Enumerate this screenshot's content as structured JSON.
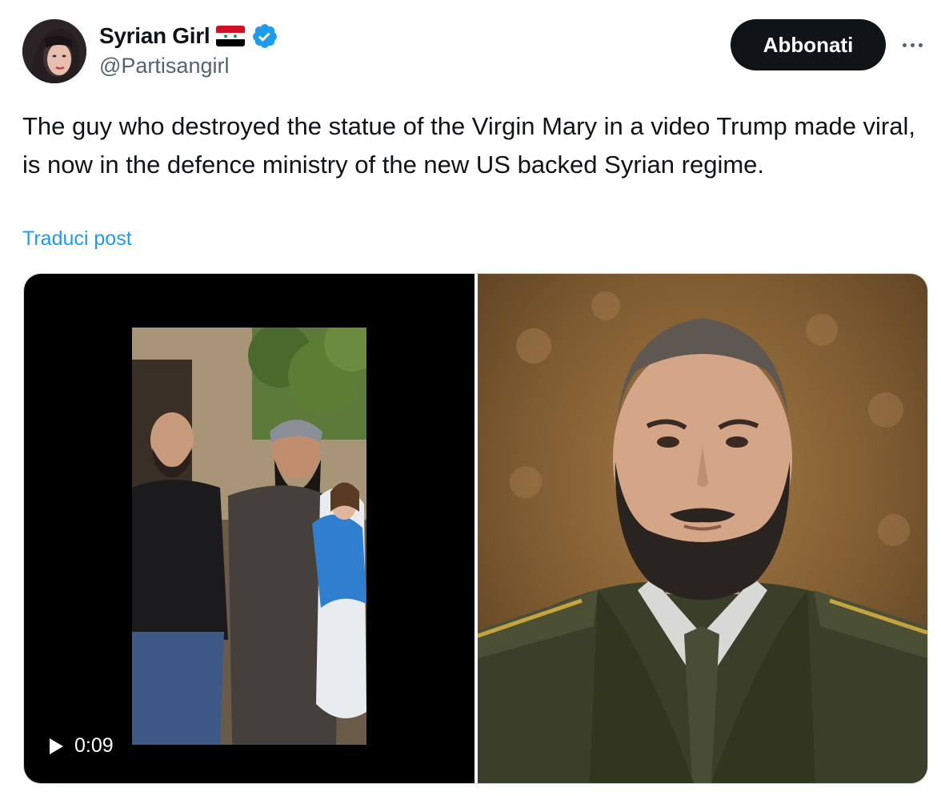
{
  "author": {
    "display_name": "Syrian Girl",
    "handle": "@Partisangirl",
    "flag_icon": "syria-flag-icon",
    "verified_icon": "verified-badge-icon",
    "verified_color": "#1d9bf0"
  },
  "actions": {
    "follow_label": "Abbonati",
    "more_icon": "more-options-icon"
  },
  "post": {
    "text": "The guy who destroyed the statue of the Virgin Mary in a video Trump made viral, is now in the defence ministry of the new US backed Syrian regime.",
    "translate_label": "Traduci post"
  },
  "media": {
    "video": {
      "duration": "0:09",
      "play_icon": "play-icon"
    },
    "photo": {
      "icon": "portrait-photo"
    }
  },
  "colors": {
    "text": "#0f1419",
    "secondary": "#536471",
    "link": "#1d9bf0",
    "button_bg": "#0f1419",
    "border": "#cfd9de"
  }
}
